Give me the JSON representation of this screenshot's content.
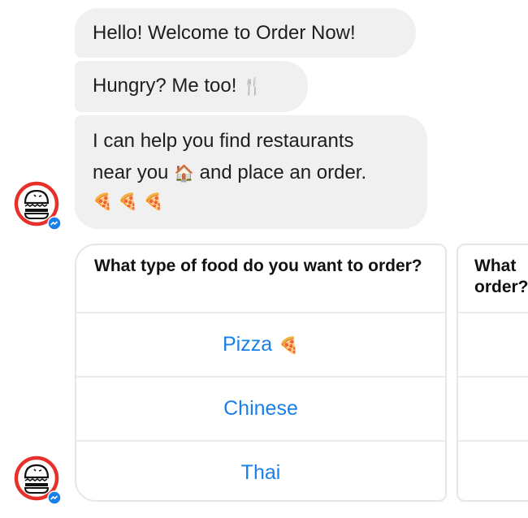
{
  "messages": [
    {
      "text": "Hello! Welcome to Order Now!"
    },
    {
      "text": "Hungry? Me too!",
      "emoji": "🍴",
      "emoji_name": "fork-and-knife"
    },
    {
      "line1": "I can help you find restaurants",
      "line2_before": "near you",
      "line2_emoji": "🏠",
      "line2_after": "and place an order.",
      "line3": "🍕 🍕 🍕"
    }
  ],
  "cards": [
    {
      "title": "What type of food do you want to order?",
      "buttons": [
        {
          "label": "Pizza",
          "emoji": "🍕"
        },
        {
          "label": "Chinese",
          "emoji": ""
        },
        {
          "label": "Thai",
          "emoji": ""
        }
      ]
    },
    {
      "title_line1": "What",
      "title_line2": "order?"
    }
  ],
  "avatar": {
    "name": "Order Now bot",
    "icon": "burger-icon",
    "badge": "messenger-icon"
  },
  "colors": {
    "bubble_bg": "#f0f0f0",
    "button_text": "#1a7fe8",
    "avatar_ring": "#e8302a",
    "messenger_badge": "#1a7fe8"
  }
}
